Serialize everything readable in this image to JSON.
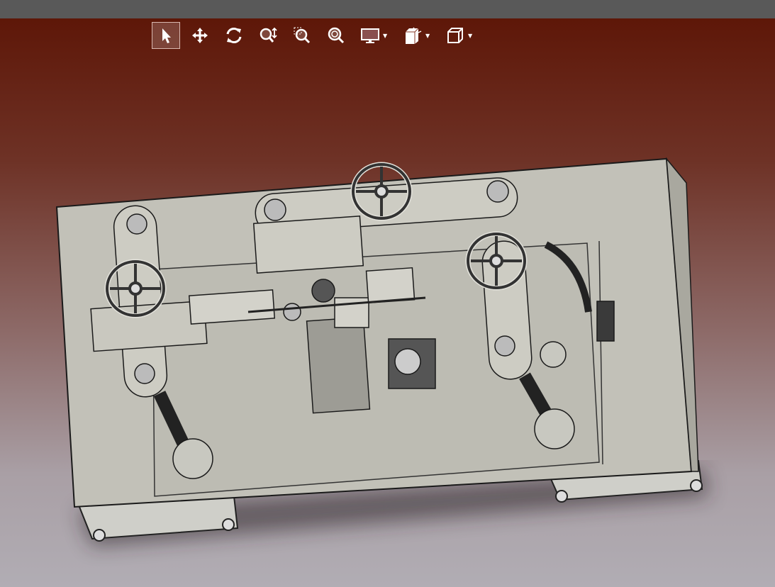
{
  "colors": {
    "titlebar": "#595959",
    "background_top": "#5e1708",
    "background_bottom": "#b1adb4",
    "model": "#c4c2b8",
    "toolbar_icon": "#ffffff"
  },
  "toolbar": {
    "tools": [
      {
        "icon": "select-arrow-icon",
        "active": true
      },
      {
        "icon": "pan-icon",
        "active": false
      },
      {
        "icon": "rotate-icon",
        "active": false
      },
      {
        "icon": "zoom-icon",
        "active": false
      },
      {
        "icon": "zoom-window-icon",
        "active": false
      },
      {
        "icon": "zoom-fit-icon",
        "active": false
      },
      {
        "icon": "display-mode-icon",
        "dropdown": true
      },
      {
        "icon": "section-view-icon",
        "dropdown": true
      },
      {
        "icon": "view-orientation-cube-icon",
        "dropdown": true
      }
    ]
  }
}
